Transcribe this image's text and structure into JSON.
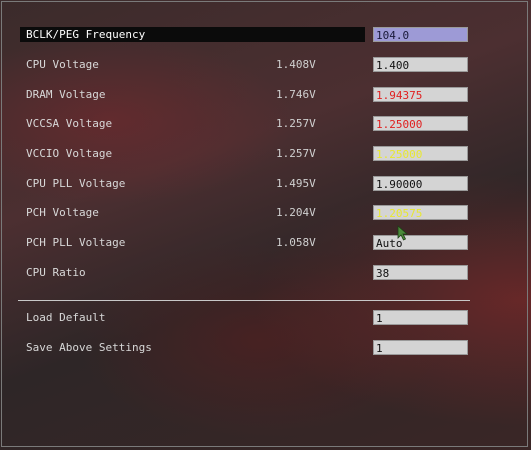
{
  "rows": [
    {
      "label": "BCLK/PEG Frequency",
      "reading": "",
      "value": "104.0"
    },
    {
      "label": "CPU Voltage",
      "reading": "1.408V",
      "value": "1.400"
    },
    {
      "label": "DRAM Voltage",
      "reading": "1.746V",
      "value": "1.94375"
    },
    {
      "label": "VCCSA Voltage",
      "reading": "1.257V",
      "value": "1.25000"
    },
    {
      "label": "VCCIO Voltage",
      "reading": "1.257V",
      "value": "1.25000"
    },
    {
      "label": "CPU PLL Voltage",
      "reading": "1.495V",
      "value": "1.90000"
    },
    {
      "label": "PCH Voltage",
      "reading": "1.204V",
      "value": "1.20575"
    },
    {
      "label": "PCH PLL Voltage",
      "reading": "1.058V",
      "value": "Auto"
    },
    {
      "label": "CPU Ratio",
      "reading": "",
      "value": "38"
    }
  ],
  "actions": [
    {
      "label": "Load Default",
      "value": "1"
    },
    {
      "label": "Save Above Settings",
      "value": "1"
    }
  ],
  "colors": {
    "selected_field": "#9d9ad6",
    "warning_red": "#e02020",
    "warning_yellow": "#e8e830"
  }
}
